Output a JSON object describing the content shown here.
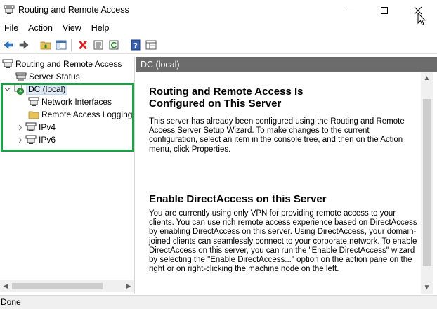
{
  "window": {
    "title": "Routing and Remote Access"
  },
  "menu": {
    "file": "File",
    "action": "Action",
    "view": "View",
    "help": "Help"
  },
  "tree": {
    "root": "Routing and Remote Access",
    "server_status": "Server Status",
    "dc": "DC (local)",
    "network_interfaces": "Network Interfaces",
    "remote_access_logging": "Remote Access Logging",
    "ipv4": "IPv4",
    "ipv6": "IPv6"
  },
  "right_pane": {
    "header": "DC (local)",
    "title1_line1": "Routing and Remote Access Is",
    "title1_line2": "Configured on This Server",
    "para1": "This server has already been configured using the Routing and Remote Access Server Setup Wizard. To make changes to the current configuration, select an item in the console tree, and then on the Action menu, click Properties.",
    "title2": "Enable DirectAccess on this Server",
    "para2": "You are currently using only VPN for providing remote access to your clients. You can use rich remote access experience based on DirectAccess by enabling DirectAccess on this server. Using DirectAccess, your domain-joined clients can seamlessly connect to your corporate network. To enable DirectAccess on this server, you can run the \"Enable DirectAccess\" wizard by selecting the \"Enable DirectAccess...\" option on the action pane on the right or on right-clicking the machine node on the left."
  },
  "status": {
    "text": "Done"
  },
  "colors": {
    "highlight": "#1e9e47",
    "header_bg": "#6c6c6c"
  }
}
